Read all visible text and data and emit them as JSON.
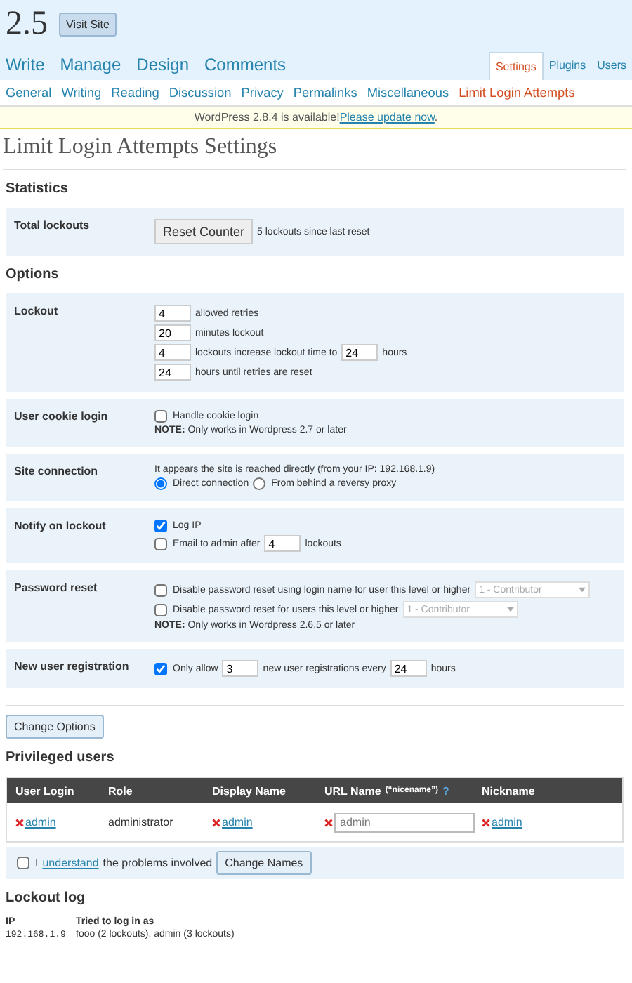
{
  "header": {
    "version": "2.5",
    "visit_site": "Visit Site"
  },
  "main_menu": [
    {
      "label": "Write",
      "selected": false
    },
    {
      "label": "Manage",
      "selected": false
    },
    {
      "label": "Design",
      "selected": false
    },
    {
      "label": "Comments",
      "selected": false
    }
  ],
  "side_menu": [
    {
      "label": "Settings",
      "selected": true
    },
    {
      "label": "Plugins",
      "selected": false
    },
    {
      "label": "Users",
      "selected": false
    }
  ],
  "submenu": [
    {
      "label": "General",
      "selected": false
    },
    {
      "label": "Writing",
      "selected": false
    },
    {
      "label": "Reading",
      "selected": false
    },
    {
      "label": "Discussion",
      "selected": false
    },
    {
      "label": "Privacy",
      "selected": false
    },
    {
      "label": "Permalinks",
      "selected": false
    },
    {
      "label": "Miscellaneous",
      "selected": false
    },
    {
      "label": "Limit Login Attempts",
      "selected": true
    }
  ],
  "notice": {
    "text": "WordPress 2.8.4 is available!",
    "link": "Please update now",
    "end": "."
  },
  "page_title": "Limit Login Attempts Settings",
  "sections": [
    {
      "heading": "Statistics",
      "rows": [
        {
          "label": "Total lockouts",
          "lines": [
            [
              {
                "kind": "button",
                "text": "Reset Counter"
              },
              {
                "kind": "text",
                "text": "5 lockouts since last reset"
              }
            ]
          ]
        }
      ]
    },
    {
      "heading": "Options",
      "rows": [
        {
          "label": "Lockout",
          "lines": [
            [
              {
                "kind": "input",
                "text": "4"
              },
              {
                "kind": "text",
                "text": "allowed retries"
              }
            ],
            [
              {
                "kind": "input",
                "text": "20"
              },
              {
                "kind": "text",
                "text": "minutes lockout"
              }
            ],
            [
              {
                "kind": "input",
                "text": "4"
              },
              {
                "kind": "text",
                "text": "lockouts increase lockout time to"
              },
              {
                "kind": "input",
                "text": "24"
              },
              {
                "kind": "text",
                "text": "hours"
              }
            ],
            [
              {
                "kind": "input",
                "text": "24"
              },
              {
                "kind": "text",
                "text": "hours until retries are reset"
              }
            ]
          ]
        },
        {
          "label": "User cookie login",
          "lines": [
            [
              {
                "kind": "checkbox",
                "text": "Handle cookie login",
                "checked": false
              }
            ],
            [
              {
                "kind": "note",
                "text": "**NOTE:** Only works in Wordpress 2.7 or later"
              }
            ]
          ]
        },
        {
          "label": "Site connection",
          "lines": [
            [
              {
                "kind": "text",
                "text": "It appears the site is reached directly (from your IP: 192.168.1.9)"
              }
            ],
            [
              {
                "kind": "radio",
                "text": "Direct connection",
                "selected": true
              },
              {
                "kind": "radio",
                "text": "From behind a reversy proxy",
                "selected": false
              }
            ]
          ]
        },
        {
          "label": "Notify on lockout",
          "lines": [
            [
              {
                "kind": "checkbox",
                "text": "Log IP",
                "checked": true
              }
            ],
            [
              {
                "kind": "checkbox",
                "text": "Email to admin after",
                "checked": false
              },
              {
                "kind": "input",
                "text": "4"
              },
              {
                "kind": "text",
                "text": "lockouts"
              }
            ]
          ]
        },
        {
          "label": "Password reset",
          "lines": [
            [
              {
                "kind": "checkbox",
                "text": "Disable password reset using login name for user this level or higher",
                "checked": false
              },
              {
                "kind": "select",
                "text": "1 - Contributor",
                "disabled": true
              }
            ],
            [
              {
                "kind": "checkbox",
                "text": "Disable password reset for users this level or higher",
                "checked": false
              },
              {
                "kind": "select",
                "text": "1 - Contributor",
                "disabled": true
              }
            ],
            [
              {
                "kind": "note",
                "text": "**NOTE:** Only works in Wordpress 2.6.5 or later"
              }
            ]
          ]
        },
        {
          "label": "New user registration",
          "lines": [
            [
              {
                "kind": "checkbox",
                "text": "Only allow",
                "checked": true
              },
              {
                "kind": "input",
                "text": "3"
              },
              {
                "kind": "text",
                "text": "new user registrations every"
              },
              {
                "kind": "input",
                "text": "24"
              },
              {
                "kind": "text",
                "text": "hours"
              }
            ]
          ]
        }
      ]
    }
  ],
  "change_options": "Change Options",
  "privileged": {
    "heading": "Privileged users",
    "columns": [
      {
        "label": "User Login"
      },
      {
        "label": "Role"
      },
      {
        "label": "Display Name"
      },
      {
        "label": "URL Name",
        "note": "(“nicename”)",
        "help": "?"
      },
      {
        "label": "Nickname"
      }
    ],
    "rows": [
      [
        {
          "kind": "removable_link",
          "text": "admin"
        },
        {
          "kind": "text",
          "text": "administrator"
        },
        {
          "kind": "removable_link",
          "text": "admin"
        },
        {
          "kind": "removable_input",
          "text": "admin"
        },
        {
          "kind": "removable_link",
          "text": "admin"
        }
      ]
    ],
    "confirm": {
      "checked": false,
      "before": "I",
      "link": "understand",
      "after": "the problems involved",
      "button": "Change Names"
    }
  },
  "lockout_log": {
    "heading": "Lockout log",
    "columns": [
      "IP",
      "Tried to log in as"
    ],
    "rows": [
      [
        "192.168.1.9",
        "fooo (2 lockouts), admin (3 lockouts)"
      ]
    ]
  }
}
